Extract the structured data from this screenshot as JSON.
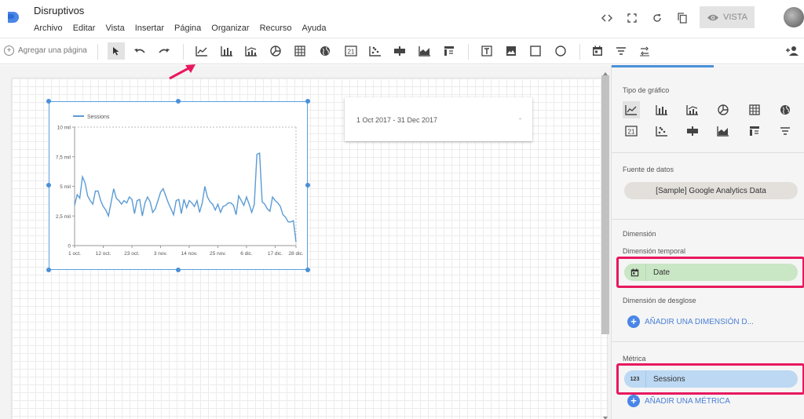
{
  "app": {
    "title": "Disruptivos"
  },
  "menu": [
    "Archivo",
    "Editar",
    "Vista",
    "Insertar",
    "Página",
    "Organizar",
    "Recurso",
    "Ayuda"
  ],
  "header": {
    "vista_label": "VISTA"
  },
  "toolbar": {
    "add_page_label": "Agregar una página"
  },
  "canvas": {
    "date_range": "1 Oct 2017 - 31 Dec 2017",
    "date_caret": "-"
  },
  "panel": {
    "chart_type_label": "Tipo de gráfico",
    "data_source_label": "Fuente de datos",
    "data_source_value": "[Sample] Google Analytics Data",
    "dimension_label": "Dimensión",
    "time_dimension_label": "Dimensión temporal",
    "time_dimension_value": "Date",
    "breakdown_label": "Dimensión de desglose",
    "add_dimension_label": "AÑADIR UNA DIMENSIÓN D...",
    "metric_label": "Métrica",
    "metric_icon_text": "123",
    "metric_value": "Sessions",
    "add_metric_label": "AÑADIR UNA MÉTRICA"
  },
  "colors": {
    "accent": "#4a90d9",
    "highlight": "#e8185e",
    "dimension_chip": "#c9e6c5",
    "metric_chip": "#bcd8f3"
  },
  "chart_data": {
    "type": "line",
    "legend": "Sessions",
    "yticks": [
      "10 mil",
      "7,5 mil",
      "5 mil",
      "2,5 mil",
      "0"
    ],
    "ylim": [
      0,
      10000
    ],
    "xticks": [
      "1 oct.",
      "12 oct.",
      "23 oct.",
      "3 nov.",
      "14 nov.",
      "25 nov.",
      "6 dic.",
      "17 dic.",
      "28 dic."
    ],
    "series": [
      {
        "name": "Sessions",
        "values": [
          3400,
          4300,
          4000,
          5800,
          5300,
          4200,
          3800,
          3500,
          4600,
          4600,
          3800,
          3300,
          3000,
          2500,
          3600,
          4800,
          4000,
          3800,
          3500,
          3800,
          3600,
          4100,
          3900,
          2700,
          3800,
          3900,
          2500,
          3600,
          4100,
          3700,
          2800,
          3100,
          3800,
          4500,
          4800,
          4200,
          3600,
          3100,
          2600,
          3800,
          3900,
          2700,
          3900,
          3200,
          3800,
          3600,
          3300,
          3800,
          2800,
          3600,
          5000,
          4100,
          3700,
          3500,
          3000,
          3500,
          2800,
          3300,
          3400,
          3600,
          3600,
          3400,
          2600,
          4200,
          3800,
          3400,
          4100,
          3500,
          2800,
          3500,
          7700,
          7800,
          3700,
          3500,
          3100,
          2900,
          4100,
          3800,
          3600,
          3300,
          2600,
          2400,
          2000,
          2000,
          2100,
          300
        ]
      }
    ]
  }
}
